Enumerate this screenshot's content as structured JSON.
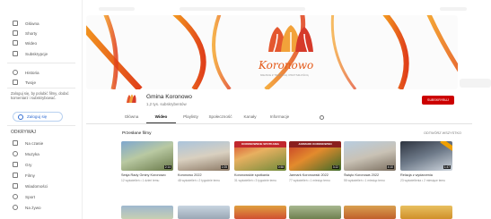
{
  "sidebar": {
    "items": [
      {
        "label": "Główna"
      },
      {
        "label": "Shorty"
      },
      {
        "label": "Wideo"
      },
      {
        "label": "Subskrypcje"
      },
      {
        "label": "Historia"
      },
      {
        "label": "Twoje"
      }
    ],
    "note": "Zaloguj się, by polubić filmy, dodać komentarz i subskrybować.",
    "login_label": "Zaloguj się",
    "explore_heading": "ODKRYWAJ",
    "explore_items": [
      {
        "label": "Na czasie"
      },
      {
        "label": "Muzyka"
      },
      {
        "label": "Gry"
      },
      {
        "label": "Filmy"
      },
      {
        "label": "Wiadomości"
      },
      {
        "label": "Sport"
      },
      {
        "label": "Na żywo"
      }
    ]
  },
  "banner": {
    "logo_text": "Koronowo",
    "logo_subtext": "MIEJSCE Z TRADYCJĄ I PRZYSZŁOŚCIĄ"
  },
  "channel": {
    "name": "Gmina Koronowo",
    "subscribers": "1,2 tys. subskrybentów",
    "subscribe_label": "SUBSKRYBUJ",
    "avatar_icon": "koronowo-logo-icon"
  },
  "tabs": [
    {
      "label": "Główna"
    },
    {
      "label": "Wideo"
    },
    {
      "label": "Playlisty"
    },
    {
      "label": "Społeczność"
    },
    {
      "label": "Kanały"
    },
    {
      "label": "Informacje"
    }
  ],
  "section": {
    "title": "Przesłane filmy",
    "play_all": "ODTWÓRZ WSZYSTKO"
  },
  "videos": [
    {
      "title": "Sesja Rady Gminy Koronowo",
      "meta": "12 wyświetleń • 1 dzień temu",
      "duration": "2:14",
      "strip": ""
    },
    {
      "title": "Koronowo 2022",
      "meta": "48 wyświetleń • 2 tygodnie temu",
      "duration": "1:05",
      "strip": ""
    },
    {
      "title": "Koronowskie spotkania",
      "meta": "31 wyświetleń • 3 tygodnie temu",
      "duration": "0:58",
      "strip": "KORONOWSKIE SPOTKANIA"
    },
    {
      "title": "Jarmark Koronowski 2022",
      "meta": "77 wyświetleń • 1 miesiąc temu",
      "duration": "3:22",
      "strip": "JARMARK KORONOWSKI"
    },
    {
      "title": "Święto Koronowa 2022",
      "meta": "55 wyświetleń • 1 miesiąc temu",
      "duration": "4:10",
      "strip": ""
    },
    {
      "title": "Relacja z wydarzenia",
      "meta": "23 wyświetlenia • 2 miesiące temu",
      "duration": "1:47",
      "strip": ""
    }
  ]
}
